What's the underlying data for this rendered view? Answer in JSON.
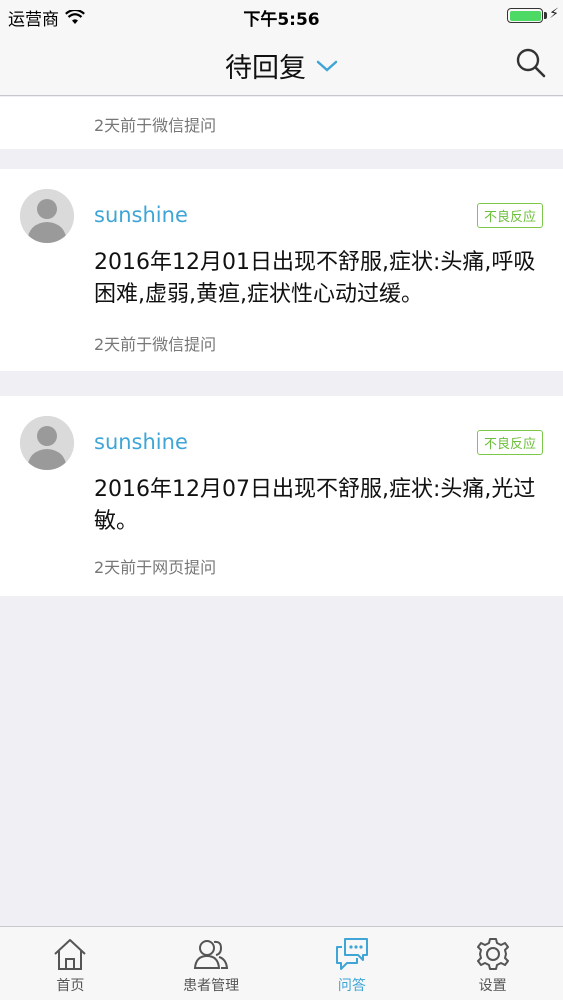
{
  "status_bar": {
    "carrier": "运营商",
    "time": "下午5:56"
  },
  "nav": {
    "title": "待回复"
  },
  "partial_item": {
    "meta": "2天前于微信提问"
  },
  "questions": [
    {
      "username": "sunshine",
      "tag": "不良反应",
      "text": "2016年12月01日出现不舒服,症状:头痛,呼吸困难,虚弱,黄疸,症状性心动过缓。",
      "meta": "2天前于微信提问"
    },
    {
      "username": "sunshine",
      "tag": "不良反应",
      "text": "2016年12月07日出现不舒服,症状:头痛,光过敏。",
      "meta": "2天前于网页提问"
    }
  ],
  "tabs": [
    {
      "label": "首页",
      "icon": "home-icon",
      "active": false
    },
    {
      "label": "患者管理",
      "icon": "patients-icon",
      "active": false
    },
    {
      "label": "问答",
      "icon": "chat-icon",
      "active": true
    },
    {
      "label": "设置",
      "icon": "gear-icon",
      "active": false
    }
  ],
  "colors": {
    "accent": "#3fa5d6",
    "tag_green": "#6cbf3a",
    "background": "#efeff4"
  }
}
